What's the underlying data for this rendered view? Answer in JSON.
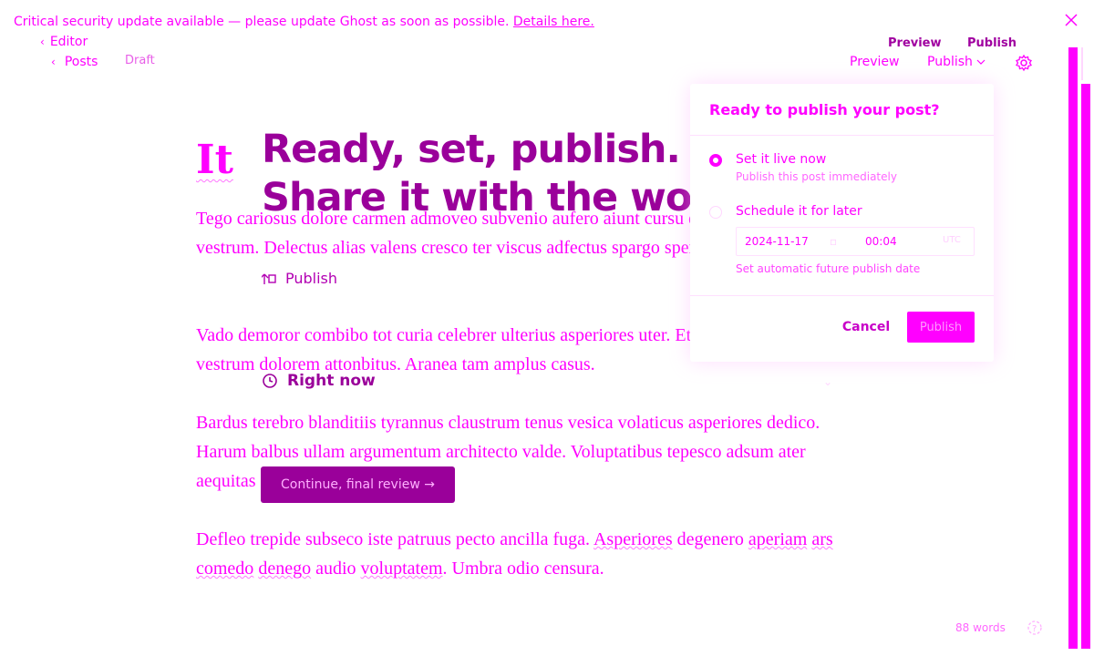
{
  "banner": {
    "message": "Critical security update available — please update Ghost as soon as possible.",
    "link": "Details here."
  },
  "nav": {
    "editor_label": "Editor",
    "posts_label": "Posts",
    "status": "Draft",
    "preview_label": "Preview",
    "publish_label": "Publish"
  },
  "post": {
    "title": "It",
    "paragraphs": [
      "Tego cariosus dolore carmen admoveo subvenio aufero aiunt cursu derelinquo tabgo in vestrum. Delectus alias valens cresco ter viscus adfectus spargo spero.",
      "Vado demoror combibo tot curia celebrer ulterius asperiores uter. Et accusantium ultio vestrum dolorem attonbitus. Aranea tam amplus casus.",
      "Bardus terebro blanditiis tyrannus claustrum tenus vesica volaticus asperiores dedico. Harum balbus ullam argumentum architecto valde. Voluptatibus tepesco adsum ater aequitas delectus collo avelo aiunt.",
      "Defleo trepide subseco iste patruus pecto ancilla fuga. "
    ],
    "para4_words": {
      "w1": "Asperiores",
      "w2": "degenero",
      "w3": "aperiam",
      "w4": "ars",
      "w5": "comedo",
      "w6": "denego",
      "w7": "audio",
      "w8": "voluptatem",
      "tail": ". Umbra odio censura."
    }
  },
  "overlay": {
    "hero_line_1": "Ready, set, publish.",
    "hero_line_2": "Share it with the world.",
    "publish_row": "Publish",
    "right_now_row": "Right now",
    "continue_label": "Continue, final review →"
  },
  "popover": {
    "title": "Ready to publish your post?",
    "option_now_title": "Set it live now",
    "option_now_desc": "Publish this post immediately",
    "option_later_title": "Schedule it for later",
    "date": "2024-11-17",
    "time": "00:04",
    "timezone": "UTC",
    "schedule_desc": "Set automatic future publish date",
    "cancel_label": "Cancel",
    "publish_label": "Publish"
  },
  "footer": {
    "word_count": "88 words"
  },
  "colors": {
    "accent": "#ff00ff",
    "dark_accent": "#9a009a",
    "background": "#ffffff"
  }
}
